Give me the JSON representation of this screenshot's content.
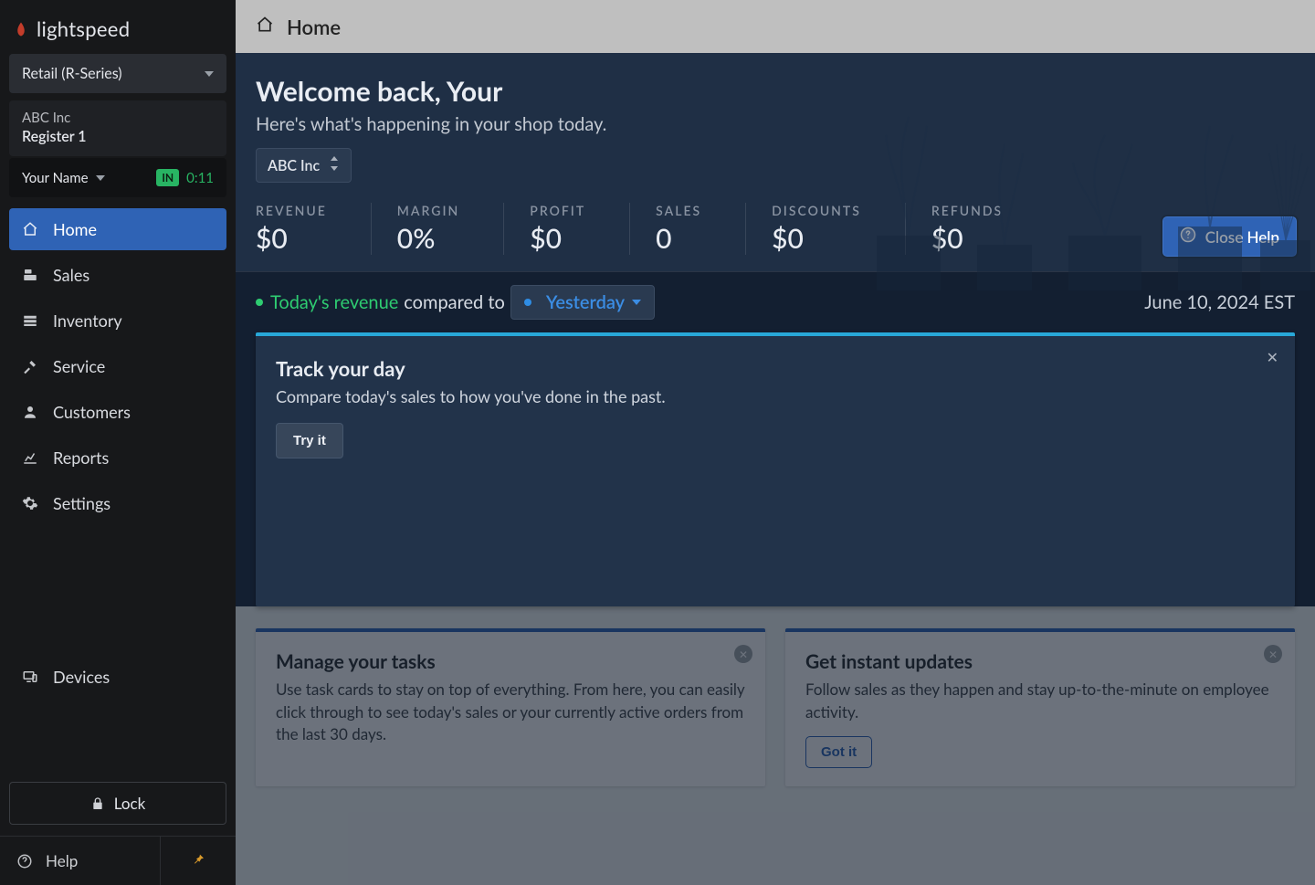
{
  "brand": "lightspeed",
  "product_switcher": "Retail (R-Series)",
  "register": {
    "company": "ABC Inc",
    "name": "Register 1"
  },
  "user": {
    "name": "Your Name",
    "status": "IN",
    "timer": "0:11"
  },
  "nav": {
    "home": "Home",
    "sales": "Sales",
    "inventory": "Inventory",
    "service": "Service",
    "customers": "Customers",
    "reports": "Reports",
    "settings": "Settings",
    "devices": "Devices"
  },
  "lock_label": "Lock",
  "help_label": "Help",
  "topbar": {
    "title": "Home"
  },
  "hero": {
    "welcome": "Welcome back, Your",
    "subtitle": "Here's what's happening in your shop today.",
    "shop": "ABC Inc"
  },
  "metrics": {
    "revenue": {
      "label": "REVENUE",
      "value": "$0"
    },
    "margin": {
      "label": "MARGIN",
      "value": "0%"
    },
    "profit": {
      "label": "PROFIT",
      "value": "$0"
    },
    "sales": {
      "label": "SALES",
      "value": "0"
    },
    "discounts": {
      "label": "DISCOUNTS",
      "value": "$0"
    },
    "refunds": {
      "label": "REFUNDS",
      "value": "$0"
    }
  },
  "close_help_label": "Close Help",
  "compare": {
    "revenue_label": "Today's revenue",
    "middle": "compared to",
    "period": "Yesterday",
    "date": "June 10, 2024 EST"
  },
  "track_card": {
    "title": "Track your day",
    "body": "Compare today's sales to how you've done in the past.",
    "button": "Try it"
  },
  "task_cards": {
    "manage": {
      "title": "Manage your tasks",
      "body": "Use task cards to stay on top of everything. From here, you can easily click through to see today's sales or your currently active orders from the last 30 days."
    },
    "updates": {
      "title": "Get instant updates",
      "body": "Follow sales as they happen and stay up-to-the-minute on employee activity.",
      "button": "Got it"
    }
  }
}
